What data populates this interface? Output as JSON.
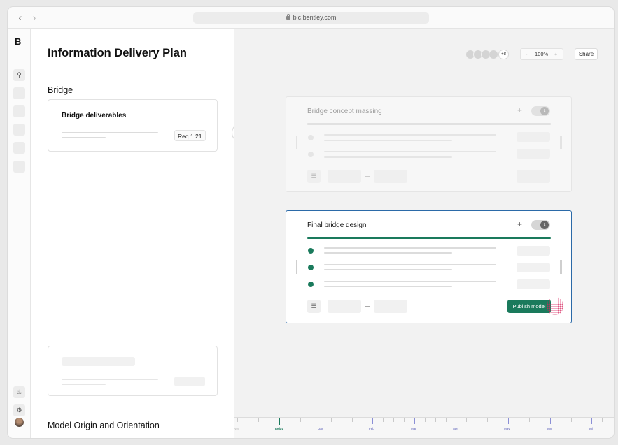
{
  "browser": {
    "url": "bic.bentley.com",
    "back_icon": "chevron-left-icon",
    "forward_icon": "chevron-right-icon"
  },
  "rail": {
    "logo": "B",
    "icons": [
      "search-icon",
      "bell-icon",
      "gear-icon"
    ]
  },
  "left_panel": {
    "title": "Information Delivery Plan",
    "section_1": "Bridge",
    "card_1": {
      "title": "Bridge deliverables",
      "badge": "Req 1.21"
    },
    "section_2": "Model Origin and Orientation"
  },
  "toolbar": {
    "avatars_more": "+8",
    "zoom_minus": "-",
    "zoom_level": "100%",
    "zoom_plus": "+",
    "share_label": "Share"
  },
  "stages": [
    {
      "title": "Bridge concept massing",
      "add": "+",
      "toggle_initial": "L",
      "active": false
    },
    {
      "title": "Final bridge design",
      "add": "+",
      "toggle_initial": "L",
      "active": true,
      "publish_label": "Publish model"
    }
  ],
  "colors": {
    "accent_green": "#1a7a5c",
    "active_border": "#2b6aa8",
    "timeline_month": "#5a5fb8"
  },
  "timeline": [
    "Nov",
    "Today",
    "Jan",
    "Feb",
    "Mar",
    "Apr",
    "May",
    "Jun",
    "Jul"
  ]
}
